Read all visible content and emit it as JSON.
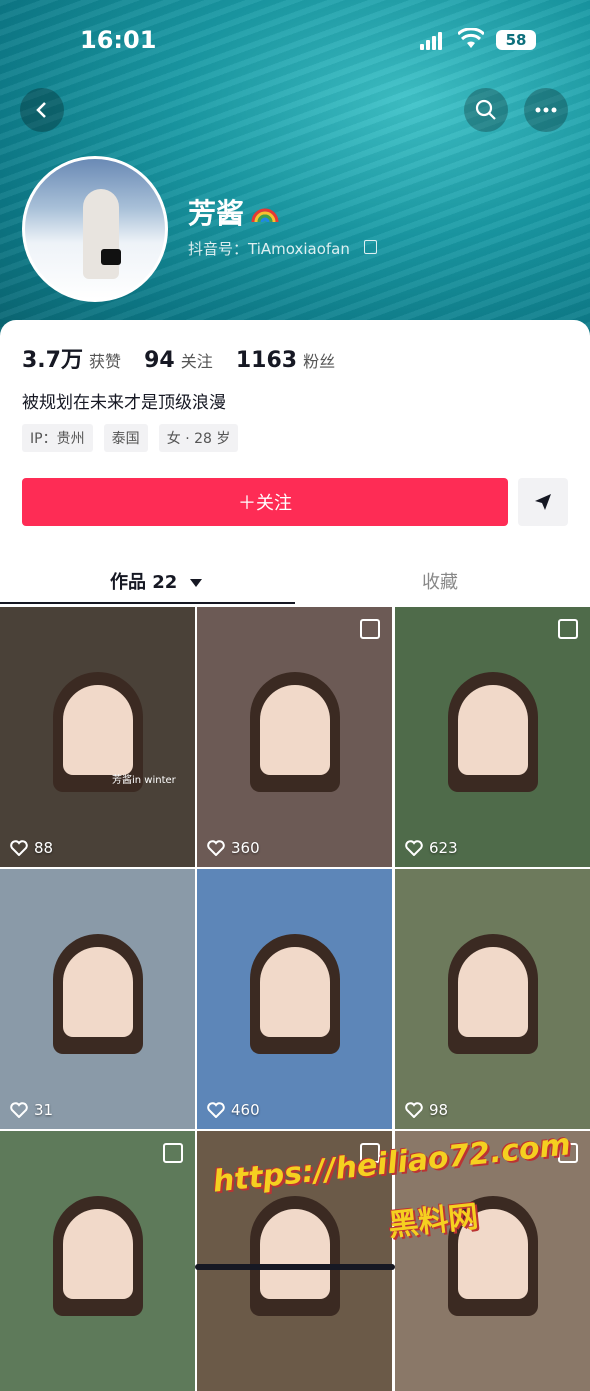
{
  "status_bar": {
    "time": "16:01",
    "battery": "58"
  },
  "profile": {
    "nickname": "芳酱",
    "douyin_id": "抖音号：TiAmoxiaofan",
    "stats": {
      "likes_value": "3.7万",
      "likes_label": "获赞",
      "following_value": "94",
      "following_label": "关注",
      "followers_value": "1163",
      "followers_label": "粉丝"
    },
    "bio": "被规划在未来才是顶级浪漫",
    "tags": [
      "IP：贵州",
      "泰国",
      "女 · 28 岁"
    ]
  },
  "actions": {
    "follow_label": "＋关注"
  },
  "tabs": {
    "works_label": "作品 22",
    "favorites_label": "收藏"
  },
  "videos": [
    {
      "likes": "88",
      "multi": false,
      "bg": "#4a4138"
    },
    {
      "likes": "360",
      "multi": true,
      "bg": "#6c5a55"
    },
    {
      "likes": "623",
      "multi": true,
      "bg": "#4f6b4a"
    },
    {
      "likes": "31",
      "multi": false,
      "bg": "#8a9aa8"
    },
    {
      "likes": "460",
      "multi": false,
      "bg": "#5d86b8"
    },
    {
      "likes": "98",
      "multi": false,
      "bg": "#6d7a5c"
    },
    {
      "likes": "",
      "multi": true,
      "bg": "#5e7a5a"
    },
    {
      "likes": "",
      "multi": true,
      "bg": "#6b5a48"
    },
    {
      "likes": "",
      "multi": true,
      "bg": "#8a7868"
    }
  ],
  "tile_text": {
    "video1_caption": "芳酱in winter"
  },
  "watermark": {
    "line1": "https://heiliao72.com",
    "line2": "黑料网"
  }
}
